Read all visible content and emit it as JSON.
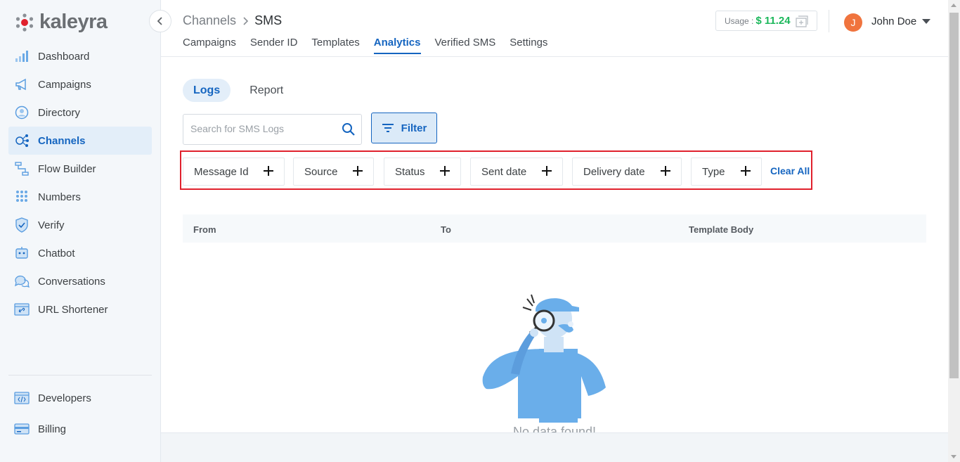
{
  "brand": {
    "name": "kaleyra",
    "accent": "#1565c0",
    "logo_color": "#e0212d"
  },
  "sidebar": {
    "items": [
      {
        "label": "Dashboard",
        "icon": "bar-chart-icon"
      },
      {
        "label": "Campaigns",
        "icon": "megaphone-icon"
      },
      {
        "label": "Directory",
        "icon": "contact-icon"
      },
      {
        "label": "Channels",
        "icon": "channels-icon",
        "active": true
      },
      {
        "label": "Flow Builder",
        "icon": "flow-icon"
      },
      {
        "label": "Numbers",
        "icon": "dialpad-icon"
      },
      {
        "label": "Verify",
        "icon": "shield-check-icon"
      },
      {
        "label": "Chatbot",
        "icon": "chatbot-icon"
      },
      {
        "label": "Conversations",
        "icon": "chat-bubbles-icon"
      },
      {
        "label": "URL Shortener",
        "icon": "link-icon"
      }
    ],
    "bottom_items": [
      {
        "label": "Developers",
        "icon": "code-icon"
      },
      {
        "label": "Billing",
        "icon": "card-icon"
      }
    ]
  },
  "header": {
    "breadcrumb_parent": "Channels",
    "breadcrumb_current": "SMS",
    "tabs": [
      {
        "label": "Campaigns"
      },
      {
        "label": "Sender ID"
      },
      {
        "label": "Templates"
      },
      {
        "label": "Analytics",
        "active": true
      },
      {
        "label": "Verified SMS"
      },
      {
        "label": "Settings"
      }
    ],
    "usage_label": "Usage :",
    "usage_value": "$ 11.24",
    "user_initial": "J",
    "user_name": "John Doe"
  },
  "main": {
    "subtabs": [
      {
        "label": "Logs",
        "active": true
      },
      {
        "label": "Report"
      }
    ],
    "search_placeholder": "Search for SMS Logs",
    "filter_label": "Filter",
    "filter_chips": [
      {
        "label": "Message Id"
      },
      {
        "label": "Source"
      },
      {
        "label": "Status"
      },
      {
        "label": "Sent date"
      },
      {
        "label": "Delivery date"
      },
      {
        "label": "Type"
      }
    ],
    "clear_all": "Clear All",
    "table_columns": [
      "From",
      "To",
      "Template Body"
    ],
    "empty_text": "No data found!"
  }
}
